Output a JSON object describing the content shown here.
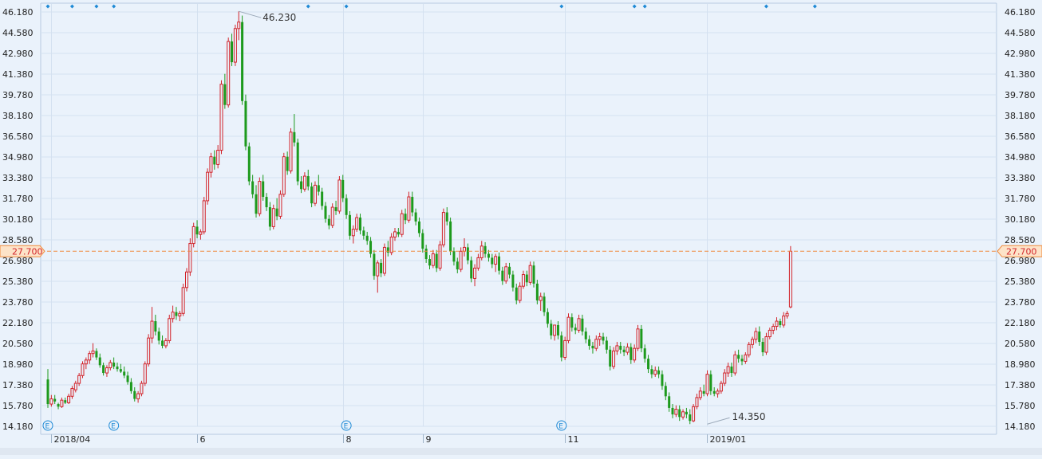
{
  "colors": {
    "background": "#eaf2fb",
    "grid": "#d4e1f0",
    "up": "#d2232a",
    "down": "#1d9a1d",
    "price_line": "#f08a3c",
    "price_tag_fill": "#fde3c8",
    "price_tag_text": "#d2232a",
    "axis_text": "#222222",
    "marker": "#1f8ad6",
    "event_marker": "#1f8ad6"
  },
  "chart_data": {
    "type": "candlestick",
    "title": "",
    "xlabel": "",
    "ylabel": "",
    "ylim": [
      14.18,
      46.18
    ],
    "y_ticks": [
      "46.180",
      "44.580",
      "42.980",
      "41.380",
      "39.780",
      "38.180",
      "36.580",
      "34.980",
      "33.380",
      "31.780",
      "30.180",
      "28.580",
      "26.980",
      "25.380",
      "23.780",
      "22.180",
      "20.580",
      "18.980",
      "17.380",
      "15.780",
      "14.180"
    ],
    "x_labels": [
      {
        "label": "2018/04",
        "index": 1
      },
      {
        "label": "6",
        "index": 43
      },
      {
        "label": "8",
        "index": 85
      },
      {
        "label": "9",
        "index": 108
      },
      {
        "label": "11",
        "index": 149
      },
      {
        "label": "2019/01",
        "index": 190
      }
    ],
    "current_price": "27.700",
    "current_price_value": 27.7,
    "high_annotation": {
      "label": "46.230",
      "index": 55,
      "value": 46.23
    },
    "low_annotation": {
      "label": "14.350",
      "index": 190,
      "value": 14.35
    },
    "event_markers": {
      "symbol": "E",
      "indices": [
        0,
        19,
        86,
        148
      ]
    },
    "top_markers": {
      "indices": [
        0,
        7,
        14,
        19,
        75,
        86,
        148,
        169,
        172,
        207,
        221
      ]
    },
    "candles": [
      [
        17.8,
        18.6,
        15.6,
        15.9
      ],
      [
        15.9,
        16.6,
        15.7,
        16.3
      ],
      [
        16.3,
        16.6,
        15.9,
        16.1
      ],
      [
        15.9,
        16.0,
        15.5,
        15.7
      ],
      [
        15.7,
        16.4,
        15.6,
        16.2
      ],
      [
        16.2,
        16.4,
        15.9,
        16.0
      ],
      [
        16.0,
        16.7,
        15.9,
        16.5
      ],
      [
        16.5,
        17.3,
        16.3,
        17.1
      ],
      [
        17.0,
        17.7,
        16.8,
        17.5
      ],
      [
        17.5,
        18.3,
        17.3,
        18.1
      ],
      [
        18.1,
        19.2,
        17.9,
        19.0
      ],
      [
        19.0,
        19.5,
        18.6,
        19.3
      ],
      [
        19.3,
        20.0,
        19.0,
        19.8
      ],
      [
        19.8,
        20.6,
        19.5,
        20.0
      ],
      [
        20.0,
        20.2,
        19.3,
        19.5
      ],
      [
        19.5,
        19.8,
        18.7,
        18.9
      ],
      [
        18.9,
        19.1,
        18.1,
        18.3
      ],
      [
        18.3,
        18.9,
        18.0,
        18.7
      ],
      [
        18.7,
        19.3,
        18.5,
        19.1
      ],
      [
        19.1,
        19.5,
        18.6,
        18.8
      ],
      [
        18.8,
        19.1,
        18.4,
        18.6
      ],
      [
        18.6,
        19.0,
        18.3,
        18.4
      ],
      [
        18.4,
        18.8,
        17.9,
        18.1
      ],
      [
        18.1,
        18.4,
        17.4,
        17.6
      ],
      [
        17.6,
        17.9,
        16.7,
        16.9
      ],
      [
        16.9,
        17.2,
        16.1,
        16.3
      ],
      [
        16.3,
        16.9,
        16.0,
        16.7
      ],
      [
        16.7,
        17.7,
        16.5,
        17.5
      ],
      [
        17.5,
        19.2,
        17.3,
        19.0
      ],
      [
        19.0,
        21.3,
        18.8,
        21.0
      ],
      [
        21.0,
        23.4,
        20.6,
        22.3
      ],
      [
        22.3,
        22.8,
        21.2,
        21.5
      ],
      [
        21.5,
        21.8,
        20.5,
        20.8
      ],
      [
        20.8,
        21.2,
        20.2,
        20.4
      ],
      [
        20.4,
        21.0,
        20.2,
        20.8
      ],
      [
        20.8,
        22.8,
        20.6,
        22.5
      ],
      [
        22.5,
        23.5,
        22.2,
        23.0
      ],
      [
        23.0,
        23.4,
        22.4,
        22.7
      ],
      [
        22.7,
        23.1,
        22.3,
        22.9
      ],
      [
        22.9,
        25.2,
        22.7,
        24.9
      ],
      [
        24.9,
        26.4,
        24.6,
        26.1
      ],
      [
        26.1,
        28.7,
        25.8,
        28.3
      ],
      [
        28.3,
        29.9,
        28.0,
        29.6
      ],
      [
        29.6,
        30.1,
        28.7,
        29.0
      ],
      [
        29.0,
        29.4,
        28.6,
        29.2
      ],
      [
        29.2,
        31.9,
        29.0,
        31.6
      ],
      [
        31.6,
        34.1,
        31.3,
        33.8
      ],
      [
        33.8,
        35.3,
        33.4,
        35.0
      ],
      [
        35.0,
        35.5,
        34.0,
        34.4
      ],
      [
        34.4,
        35.9,
        34.1,
        35.5
      ],
      [
        35.5,
        40.9,
        35.2,
        40.6
      ],
      [
        40.6,
        41.4,
        38.7,
        39.0
      ],
      [
        39.0,
        44.2,
        38.8,
        43.9
      ],
      [
        43.9,
        44.5,
        42.0,
        42.3
      ],
      [
        42.3,
        45.2,
        42.0,
        44.9
      ],
      [
        44.9,
        46.23,
        44.0,
        45.4
      ],
      [
        45.4,
        45.9,
        39.0,
        39.3
      ],
      [
        39.3,
        39.8,
        35.5,
        35.8
      ],
      [
        35.8,
        36.1,
        32.8,
        33.1
      ],
      [
        33.1,
        33.6,
        31.8,
        32.1
      ],
      [
        32.1,
        32.8,
        30.3,
        30.6
      ],
      [
        30.6,
        33.4,
        30.4,
        33.1
      ],
      [
        33.1,
        33.6,
        31.6,
        31.9
      ],
      [
        31.9,
        32.2,
        30.8,
        31.1
      ],
      [
        31.1,
        31.5,
        29.3,
        29.6
      ],
      [
        29.6,
        31.3,
        29.4,
        31.0
      ],
      [
        31.0,
        31.8,
        30.1,
        30.4
      ],
      [
        30.4,
        32.4,
        30.2,
        32.1
      ],
      [
        32.1,
        35.3,
        31.9,
        35.0
      ],
      [
        35.0,
        35.4,
        33.6,
        33.9
      ],
      [
        33.9,
        37.2,
        33.7,
        36.9
      ],
      [
        36.9,
        38.3,
        35.8,
        36.1
      ],
      [
        36.1,
        36.4,
        32.8,
        33.1
      ],
      [
        33.1,
        33.5,
        32.2,
        32.5
      ],
      [
        32.5,
        33.8,
        32.3,
        33.5
      ],
      [
        33.5,
        34.0,
        32.4,
        32.7
      ],
      [
        32.7,
        33.0,
        31.1,
        31.4
      ],
      [
        31.4,
        33.1,
        31.2,
        32.8
      ],
      [
        32.8,
        33.6,
        32.0,
        32.3
      ],
      [
        32.3,
        32.6,
        30.9,
        31.2
      ],
      [
        31.2,
        31.5,
        29.9,
        30.2
      ],
      [
        30.2,
        30.5,
        29.4,
        29.7
      ],
      [
        29.7,
        31.4,
        29.5,
        31.1
      ],
      [
        31.1,
        31.6,
        30.5,
        30.8
      ],
      [
        30.8,
        33.5,
        30.6,
        33.2
      ],
      [
        33.2,
        33.6,
        31.5,
        31.8
      ],
      [
        31.8,
        32.1,
        30.2,
        30.5
      ],
      [
        30.5,
        30.8,
        28.6,
        28.9
      ],
      [
        28.9,
        29.7,
        28.3,
        29.4
      ],
      [
        29.4,
        30.6,
        29.2,
        30.3
      ],
      [
        30.3,
        30.6,
        29.0,
        29.3
      ],
      [
        29.3,
        29.6,
        28.6,
        28.9
      ],
      [
        28.9,
        29.2,
        28.2,
        28.5
      ],
      [
        28.5,
        28.8,
        27.2,
        27.5
      ],
      [
        27.5,
        27.8,
        25.5,
        25.8
      ],
      [
        25.8,
        27.0,
        24.5,
        26.8
      ],
      [
        26.8,
        27.1,
        25.7,
        26.0
      ],
      [
        26.0,
        28.3,
        25.8,
        28.0
      ],
      [
        28.0,
        28.5,
        27.3,
        27.6
      ],
      [
        27.6,
        29.1,
        27.4,
        28.8
      ],
      [
        28.8,
        29.5,
        28.5,
        29.2
      ],
      [
        29.2,
        29.5,
        28.8,
        29.0
      ],
      [
        29.0,
        30.9,
        28.8,
        30.6
      ],
      [
        30.6,
        31.0,
        29.8,
        30.1
      ],
      [
        30.1,
        32.3,
        29.9,
        31.9
      ],
      [
        31.9,
        32.3,
        30.4,
        30.7
      ],
      [
        30.7,
        31.0,
        29.7,
        30.0
      ],
      [
        30.0,
        30.3,
        28.8,
        29.1
      ],
      [
        29.1,
        29.4,
        27.6,
        27.9
      ],
      [
        27.9,
        28.2,
        26.8,
        27.1
      ],
      [
        27.1,
        27.4,
        26.3,
        26.6
      ],
      [
        26.6,
        27.8,
        26.4,
        27.5
      ],
      [
        27.5,
        27.8,
        26.1,
        26.4
      ],
      [
        26.4,
        28.5,
        26.2,
        28.2
      ],
      [
        28.2,
        31.0,
        28.0,
        30.7
      ],
      [
        30.7,
        31.1,
        29.7,
        30.0
      ],
      [
        30.0,
        30.3,
        27.4,
        27.7
      ],
      [
        27.7,
        28.0,
        26.6,
        26.9
      ],
      [
        26.9,
        27.2,
        26.0,
        26.3
      ],
      [
        26.3,
        28.0,
        26.1,
        27.7
      ],
      [
        27.7,
        28.7,
        27.3,
        28.0
      ],
      [
        28.0,
        28.3,
        26.7,
        27.0
      ],
      [
        27.0,
        27.3,
        25.3,
        25.6
      ],
      [
        25.6,
        26.7,
        25.0,
        26.4
      ],
      [
        26.4,
        27.5,
        26.2,
        27.2
      ],
      [
        27.2,
        28.5,
        27.0,
        28.1
      ],
      [
        28.1,
        28.4,
        27.2,
        27.5
      ],
      [
        27.5,
        27.8,
        26.9,
        27.2
      ],
      [
        27.2,
        27.5,
        26.4,
        26.7
      ],
      [
        26.7,
        27.5,
        26.1,
        27.3
      ],
      [
        27.3,
        27.6,
        25.9,
        26.2
      ],
      [
        26.2,
        26.5,
        25.1,
        25.4
      ],
      [
        25.4,
        26.8,
        25.2,
        26.5
      ],
      [
        26.5,
        26.8,
        25.6,
        25.9
      ],
      [
        25.9,
        26.2,
        24.6,
        24.9
      ],
      [
        24.9,
        25.2,
        23.6,
        23.9
      ],
      [
        23.9,
        25.3,
        23.7,
        25.0
      ],
      [
        25.0,
        26.2,
        24.8,
        25.9
      ],
      [
        25.9,
        26.2,
        25.0,
        25.3
      ],
      [
        25.3,
        26.9,
        25.1,
        26.6
      ],
      [
        26.6,
        26.9,
        24.9,
        25.2
      ],
      [
        25.2,
        25.5,
        23.6,
        23.9
      ],
      [
        23.9,
        24.5,
        23.1,
        24.2
      ],
      [
        24.2,
        24.5,
        22.7,
        23.0
      ],
      [
        23.0,
        23.3,
        21.8,
        22.1
      ],
      [
        22.1,
        22.4,
        20.9,
        21.2
      ],
      [
        21.2,
        21.5,
        20.8,
        22.0
      ],
      [
        22.0,
        22.3,
        20.9,
        21.2
      ],
      [
        21.2,
        21.5,
        19.2,
        19.5
      ],
      [
        19.5,
        21.1,
        19.3,
        20.8
      ],
      [
        20.8,
        22.9,
        20.6,
        22.6
      ],
      [
        22.6,
        22.9,
        21.5,
        21.8
      ],
      [
        21.8,
        22.1,
        21.3,
        21.6
      ],
      [
        21.6,
        22.8,
        21.4,
        22.5
      ],
      [
        22.5,
        22.8,
        21.2,
        21.5
      ],
      [
        21.5,
        21.8,
        20.6,
        20.9
      ],
      [
        20.9,
        21.2,
        20.1,
        20.4
      ],
      [
        20.4,
        20.7,
        19.8,
        20.2
      ],
      [
        20.2,
        21.2,
        20.0,
        20.9
      ],
      [
        20.9,
        21.4,
        20.4,
        21.1
      ],
      [
        21.1,
        21.4,
        20.5,
        20.8
      ],
      [
        20.8,
        21.1,
        19.8,
        20.1
      ],
      [
        20.1,
        20.4,
        18.5,
        18.8
      ],
      [
        18.8,
        20.3,
        18.6,
        20.0
      ],
      [
        20.0,
        20.7,
        19.7,
        20.4
      ],
      [
        20.4,
        20.7,
        19.8,
        20.1
      ],
      [
        20.1,
        20.4,
        19.6,
        19.9
      ],
      [
        19.9,
        20.6,
        19.7,
        20.3
      ],
      [
        20.3,
        20.6,
        19.0,
        19.3
      ],
      [
        19.3,
        20.5,
        19.1,
        20.2
      ],
      [
        20.2,
        22.0,
        20.0,
        21.7
      ],
      [
        21.7,
        22.0,
        19.9,
        20.2
      ],
      [
        20.2,
        20.5,
        19.1,
        19.4
      ],
      [
        19.4,
        19.7,
        18.3,
        18.6
      ],
      [
        18.6,
        18.9,
        17.9,
        18.2
      ],
      [
        18.2,
        18.8,
        18.0,
        18.5
      ],
      [
        18.5,
        18.8,
        17.9,
        18.2
      ],
      [
        18.2,
        18.5,
        17.0,
        17.3
      ],
      [
        17.3,
        17.6,
        16.2,
        16.5
      ],
      [
        16.5,
        16.8,
        15.3,
        15.6
      ],
      [
        15.6,
        15.9,
        14.8,
        15.1
      ],
      [
        15.1,
        15.8,
        14.9,
        15.5
      ],
      [
        15.5,
        15.8,
        14.6,
        14.9
      ],
      [
        14.9,
        15.5,
        14.7,
        15.3
      ],
      [
        15.3,
        15.6,
        14.8,
        15.1
      ],
      [
        15.1,
        15.5,
        14.35,
        14.6
      ],
      [
        14.6,
        15.9,
        14.5,
        15.7
      ],
      [
        15.7,
        16.7,
        15.5,
        16.4
      ],
      [
        16.4,
        17.2,
        16.2,
        16.9
      ],
      [
        16.9,
        17.4,
        16.5,
        16.7
      ],
      [
        16.7,
        18.5,
        16.5,
        18.2
      ],
      [
        18.2,
        18.5,
        16.6,
        16.9
      ],
      [
        16.9,
        17.2,
        16.5,
        16.7
      ],
      [
        16.7,
        17.1,
        16.4,
        16.9
      ],
      [
        16.9,
        17.7,
        16.7,
        17.5
      ],
      [
        17.5,
        18.6,
        17.3,
        18.3
      ],
      [
        18.3,
        19.1,
        18.0,
        18.8
      ],
      [
        18.8,
        19.1,
        18.0,
        18.3
      ],
      [
        18.3,
        20.0,
        18.1,
        19.7
      ],
      [
        19.7,
        20.1,
        19.1,
        19.4
      ],
      [
        19.4,
        19.7,
        18.9,
        19.2
      ],
      [
        19.2,
        19.9,
        19.0,
        19.7
      ],
      [
        19.7,
        20.7,
        19.5,
        20.5
      ],
      [
        20.5,
        21.1,
        20.2,
        20.9
      ],
      [
        20.9,
        21.8,
        20.6,
        21.5
      ],
      [
        21.5,
        21.9,
        20.4,
        20.7
      ],
      [
        20.7,
        21.0,
        19.6,
        19.9
      ],
      [
        19.9,
        21.4,
        19.7,
        21.1
      ],
      [
        21.1,
        21.8,
        20.9,
        21.6
      ],
      [
        21.6,
        22.1,
        21.3,
        21.9
      ],
      [
        21.9,
        22.6,
        21.6,
        22.3
      ],
      [
        22.3,
        22.5,
        21.8,
        22.0
      ],
      [
        22.0,
        23.0,
        21.8,
        22.7
      ],
      [
        22.7,
        23.1,
        22.5,
        22.9
      ],
      [
        23.4,
        28.1,
        23.3,
        27.7
      ]
    ]
  }
}
